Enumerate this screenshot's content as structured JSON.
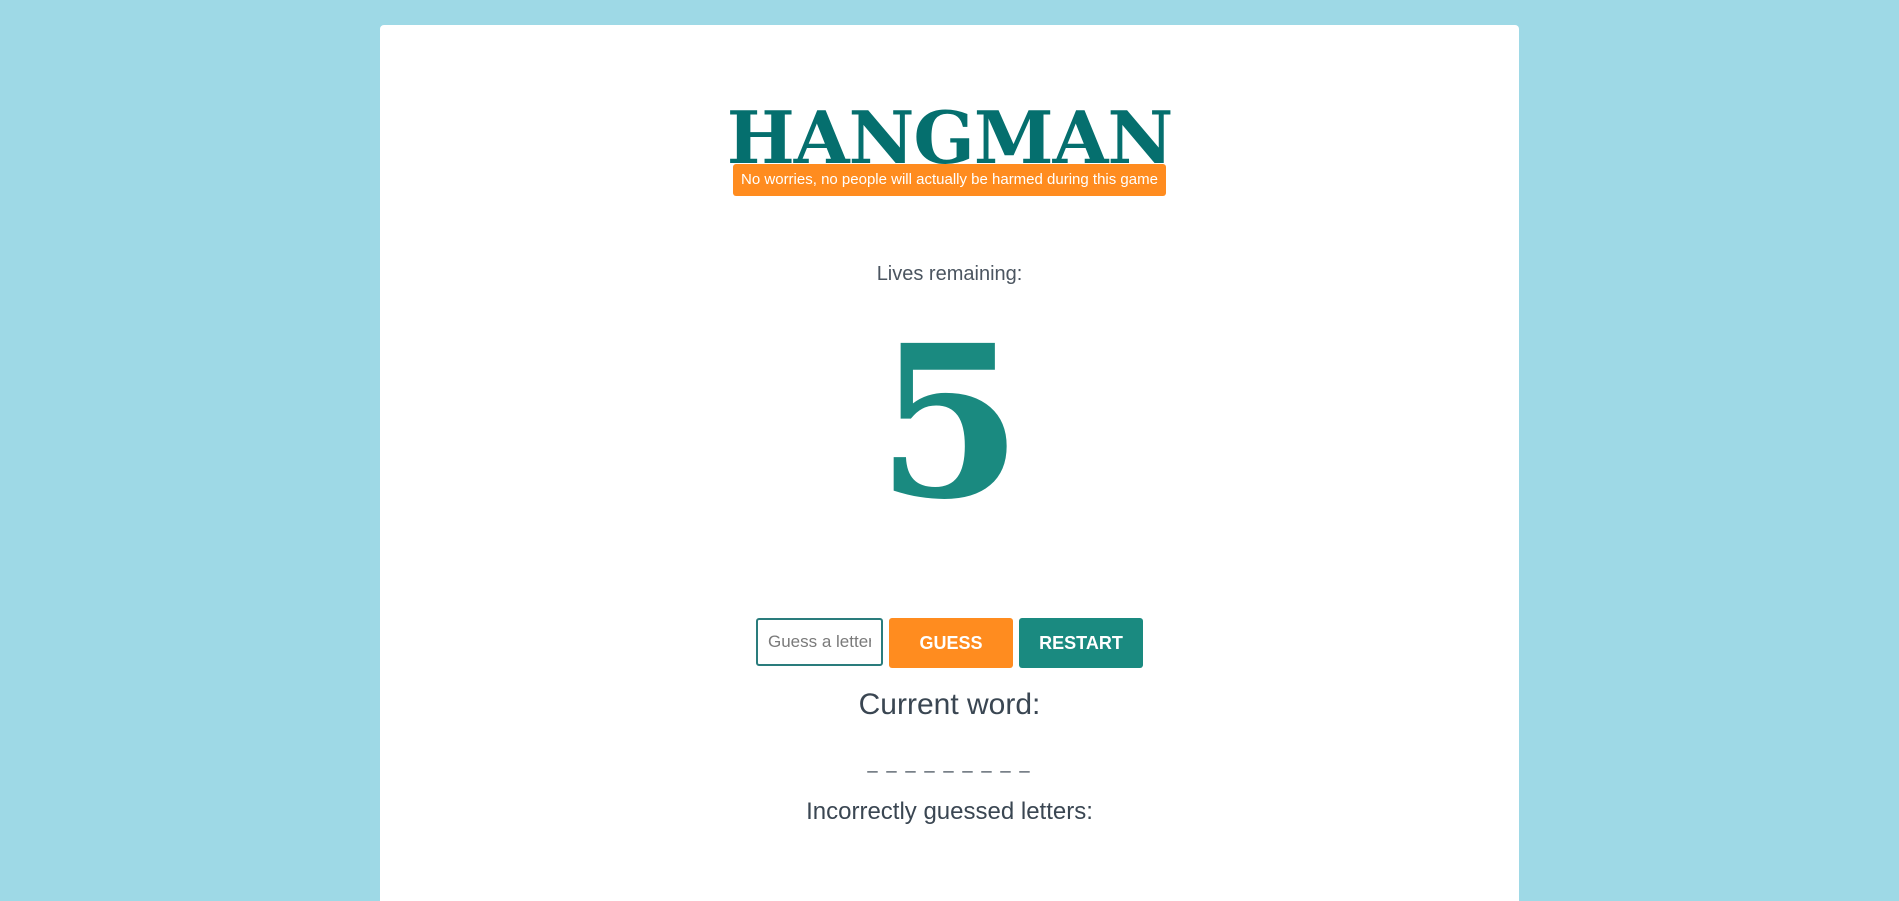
{
  "game": {
    "title": "HANGMAN",
    "disclaimer": "No worries, no people will actually be harmed during this game",
    "lives_label": "Lives remaining:",
    "lives_remaining": 5,
    "lives_display": "5"
  },
  "controls": {
    "guess_input_placeholder": "Guess a letter",
    "guess_input_value": "",
    "guess_button_label": "GUESS",
    "restart_button_label": "RESTART"
  },
  "word": {
    "label": "Current word:",
    "blanks": "_ _ _ _ _ _ _ _ _"
  },
  "incorrect": {
    "label": "Incorrectly guessed letters:",
    "letters": ""
  },
  "colors": {
    "background": "#9ed9e6",
    "title": "#056f6e",
    "accent_orange": "#ff8c1f",
    "accent_teal": "#1a8a80",
    "text": "#3a4652"
  }
}
